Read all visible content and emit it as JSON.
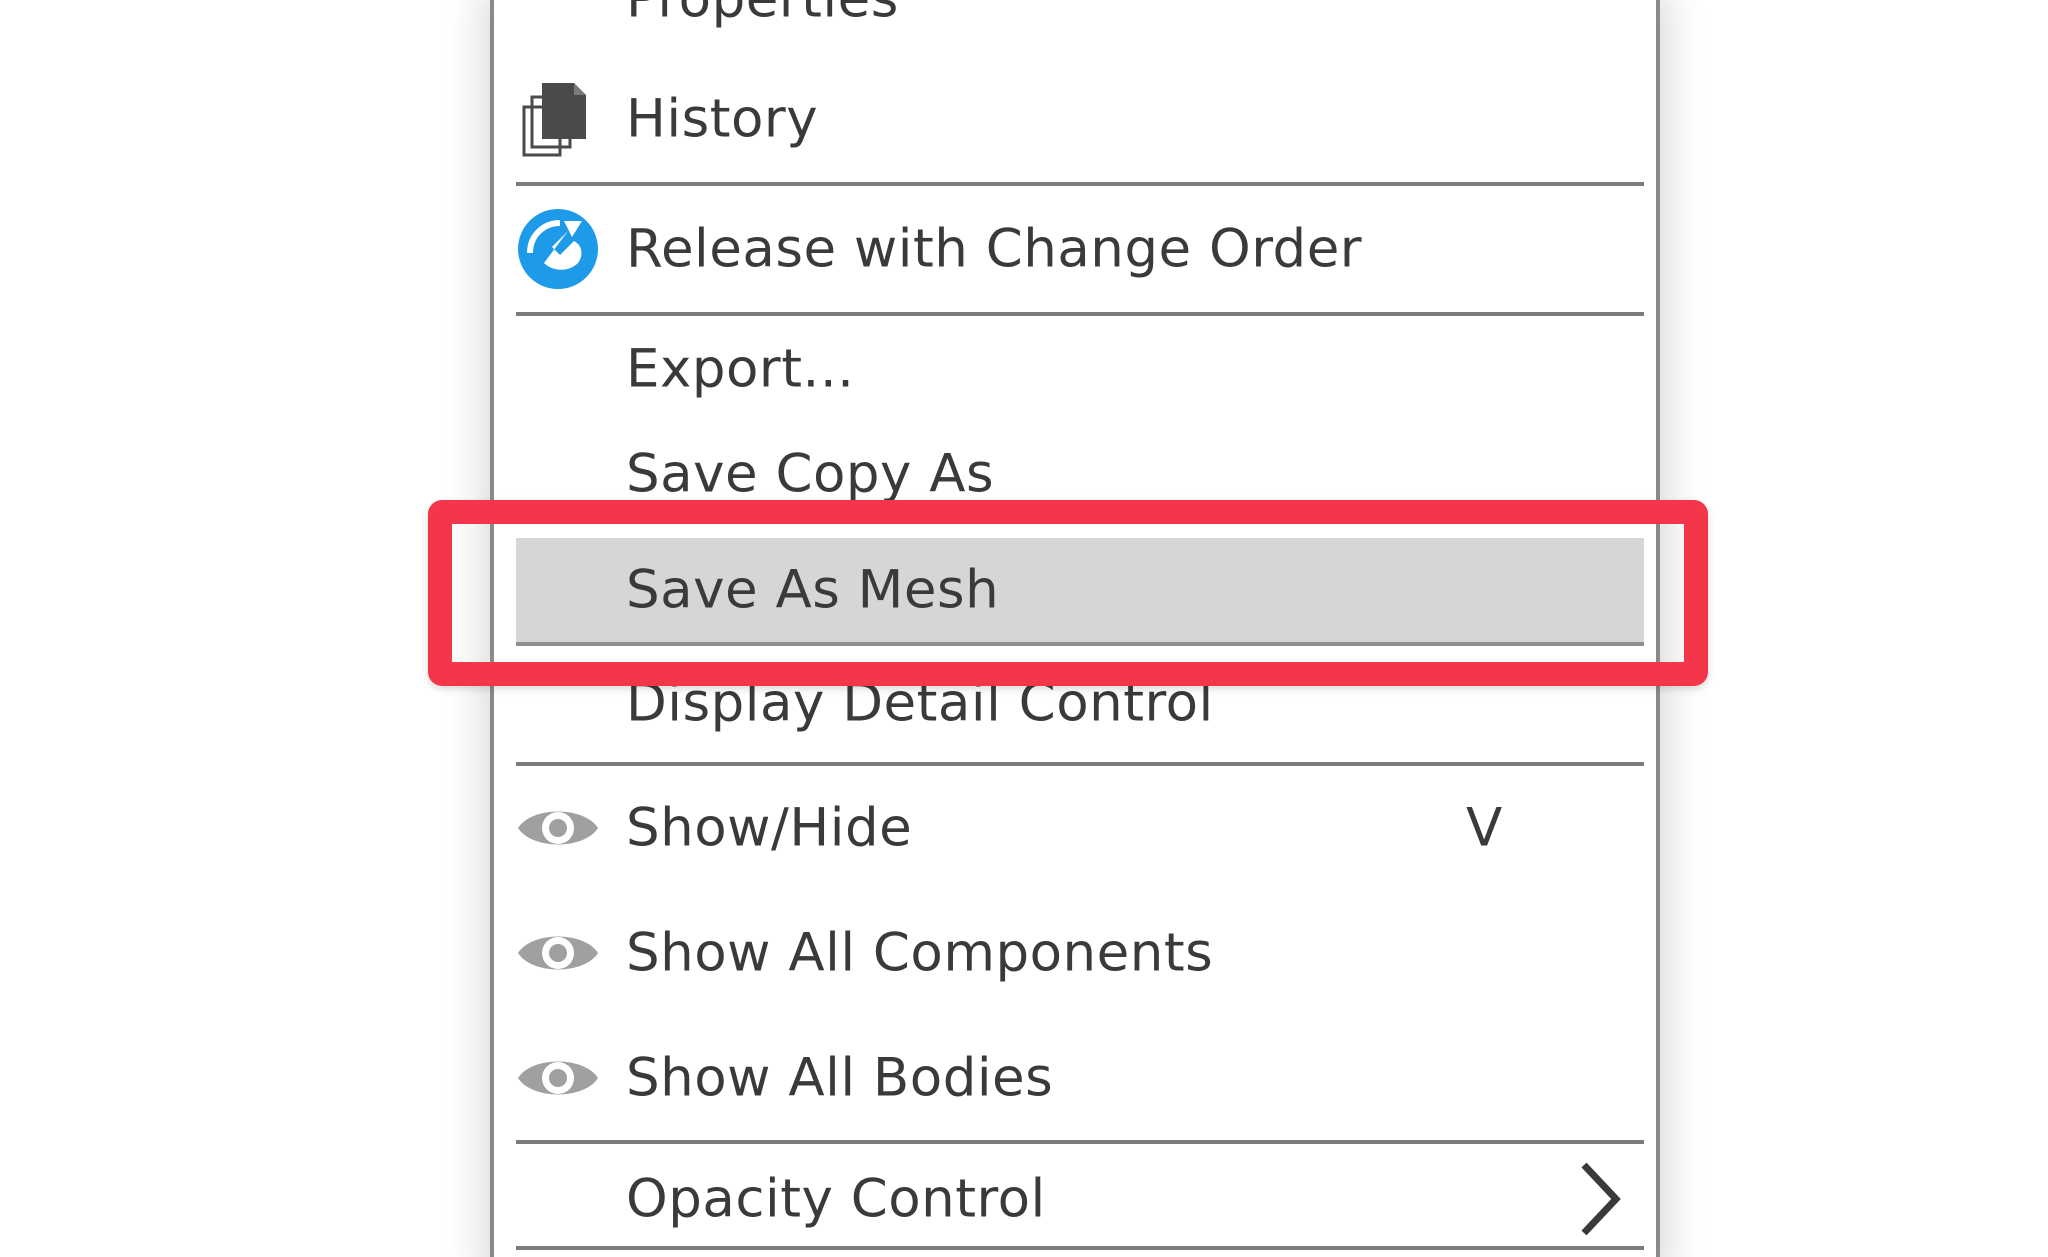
{
  "menu": {
    "items": [
      {
        "label": "Properties",
        "icon": null
      },
      {
        "label": "History",
        "icon": "history-pages-icon"
      },
      {
        "label": "Release with Change Order",
        "icon": "release-change-order-icon",
        "icon_color": "#1e9be8"
      },
      {
        "label": "Export...",
        "icon": null
      },
      {
        "label": "Save Copy As",
        "icon": null
      },
      {
        "label": "Save As Mesh",
        "icon": null,
        "highlighted": true
      },
      {
        "label": "Display Detail Control",
        "icon": null
      },
      {
        "label": "Show/Hide",
        "icon": "eye-icon",
        "shortcut": "V"
      },
      {
        "label": "Show All Components",
        "icon": "eye-icon"
      },
      {
        "label": "Show All Bodies",
        "icon": "eye-icon"
      },
      {
        "label": "Opacity Control",
        "icon": null,
        "submenu": "chevron-right-icon"
      }
    ]
  },
  "colors": {
    "highlight_bg": "#d6d6d6",
    "callout_border": "#f3364a",
    "text": "#3a3a3a",
    "separator": "#7c7c7c",
    "eye_icon": "#a0a0a0"
  }
}
